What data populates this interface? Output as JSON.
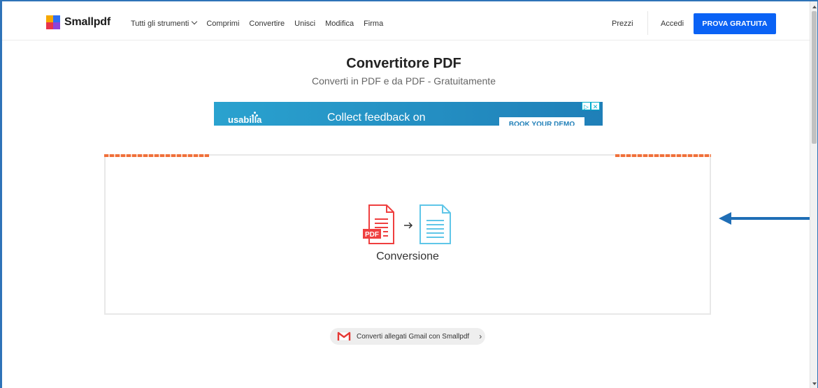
{
  "header": {
    "brand": "Smallpdf",
    "nav": [
      {
        "label": "Tutti gli strumenti",
        "dropdown": true
      },
      {
        "label": "Comprimi"
      },
      {
        "label": "Convertire"
      },
      {
        "label": "Unisci"
      },
      {
        "label": "Modifica"
      },
      {
        "label": "Firma"
      }
    ],
    "prices_label": "Prezzi",
    "login_label": "Accedi",
    "cta_label": "PROVA GRATUITA",
    "cta_color": "#0a62f5"
  },
  "page": {
    "title": "Convertitore PDF",
    "subtitle": "Converti in PDF e da PDF - Gratuitamente"
  },
  "ad": {
    "brand": "usabilla",
    "headline": "Collect feedback on",
    "button": "BOOK YOUR DEMO"
  },
  "dropzone": {
    "label": "Conversione",
    "source_icon_text": "PDF",
    "source_color": "#ef3f3f",
    "target_color": "#5fc6e8"
  },
  "gmail_link": {
    "label": "Converti allegati Gmail con Smallpdf",
    "chevron": "›"
  }
}
